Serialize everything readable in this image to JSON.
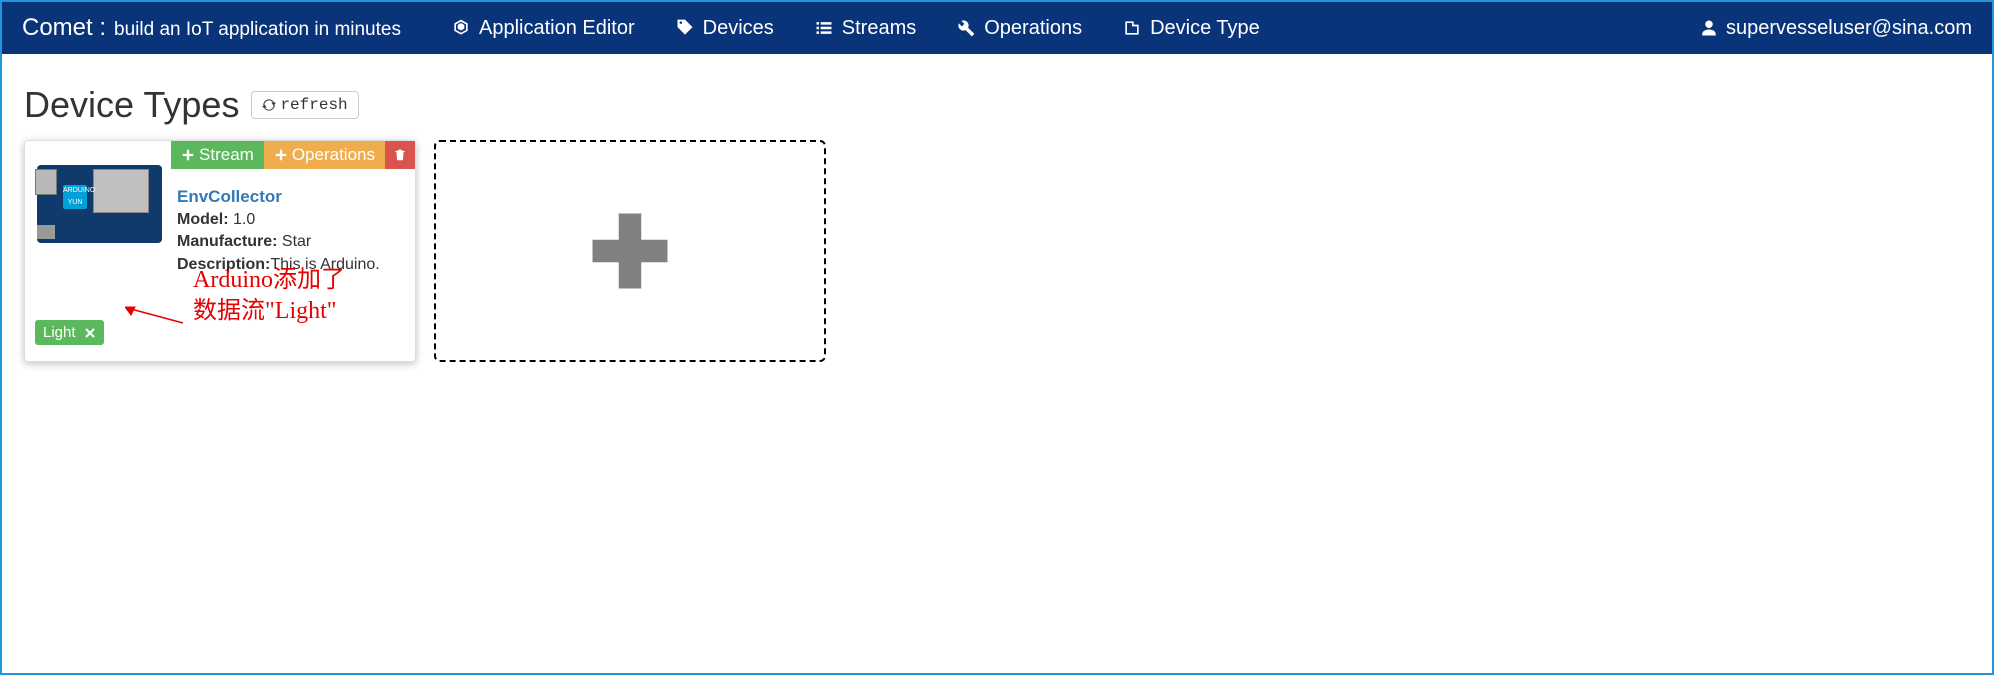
{
  "brand": {
    "name": "Comet :",
    "tagline": "build an IoT application in minutes"
  },
  "nav": {
    "app_editor": "Application Editor",
    "devices": "Devices",
    "streams": "Streams",
    "operations": "Operations",
    "device_type": "Device Type"
  },
  "user": {
    "email": "supervesseluser@sina.com"
  },
  "page": {
    "title": "Device Types",
    "refresh_label": "refresh"
  },
  "card": {
    "actions": {
      "stream": "Stream",
      "operations": "Operations"
    },
    "name": "EnvCollector",
    "model_label": "Model:",
    "model_value": "1.0",
    "manufacture_label": "Manufacture:",
    "manufacture_value": "Star",
    "description_label": "Description:",
    "description_value": "This is Arduino.",
    "board_text": "ARDUINO YUN",
    "tag": "Light"
  },
  "annotation": {
    "line1": "Arduino添加了",
    "line2": "数据流\"Light\""
  }
}
